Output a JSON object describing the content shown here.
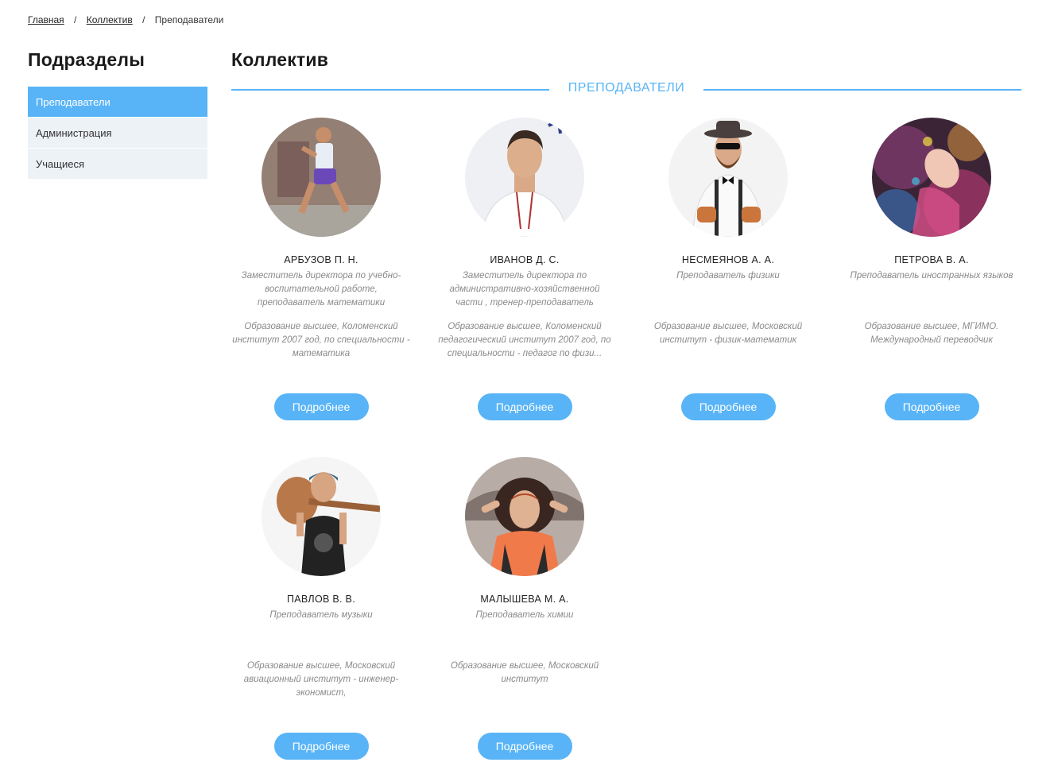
{
  "breadcrumb": {
    "home": "Главная",
    "collective": "Коллектив",
    "current": "Преподаватели",
    "separator": "/"
  },
  "sidebar": {
    "title": "Подразделы",
    "items": [
      {
        "label": "Преподаватели",
        "active": true
      },
      {
        "label": "Администрация",
        "active": false
      },
      {
        "label": "Учащиеся",
        "active": false
      }
    ]
  },
  "main": {
    "title": "Коллектив",
    "section_label": "ПРЕПОДАВАТЕЛИ"
  },
  "colors": {
    "accent": "#58b4f7",
    "sidebar_bg": "#edf2f7",
    "muted_text": "#8a8a8a"
  },
  "teachers": [
    {
      "name": "АРБУЗОВ П. Н.",
      "role": "Заместитель директора по учебно-воспитательной работе, преподаватель математики",
      "education": "Образование высшее, Коломенский институт 2007 год, по специальности - математика",
      "button": "Подробнее"
    },
    {
      "name": "ИВАНОВ Д. С.",
      "role": "Заместитель директора по административно-хозяйственной части , тренер-преподаватель",
      "education": "Образование высшее, Коломенский педагогический институт 2007 год, по специальности - педагог по физи...",
      "button": "Подробнее"
    },
    {
      "name": "НЕСМЕЯНОВ А. А.",
      "role": "Преподаватель физики",
      "education": "Образование  высшее, Московский институт - физик-математик",
      "button": "Подробнее"
    },
    {
      "name": "ПЕТРОВА В. А.",
      "role": "Преподаватель иностранных языков",
      "education": "Образование высшее, МГИМО. Международный переводчик",
      "button": "Подробнее"
    },
    {
      "name": "ПАВЛОВ В. В.",
      "role": "Преподаватель музыки",
      "education": "Образование  высшее, Московский авиационный институт - инженер-экономист,",
      "button": "Подробнее"
    },
    {
      "name": "МАЛЫШЕВА М. А.",
      "role": "Преподаватель химии",
      "education": "Образование высшее, Московский институт",
      "button": "Подробнее"
    }
  ]
}
